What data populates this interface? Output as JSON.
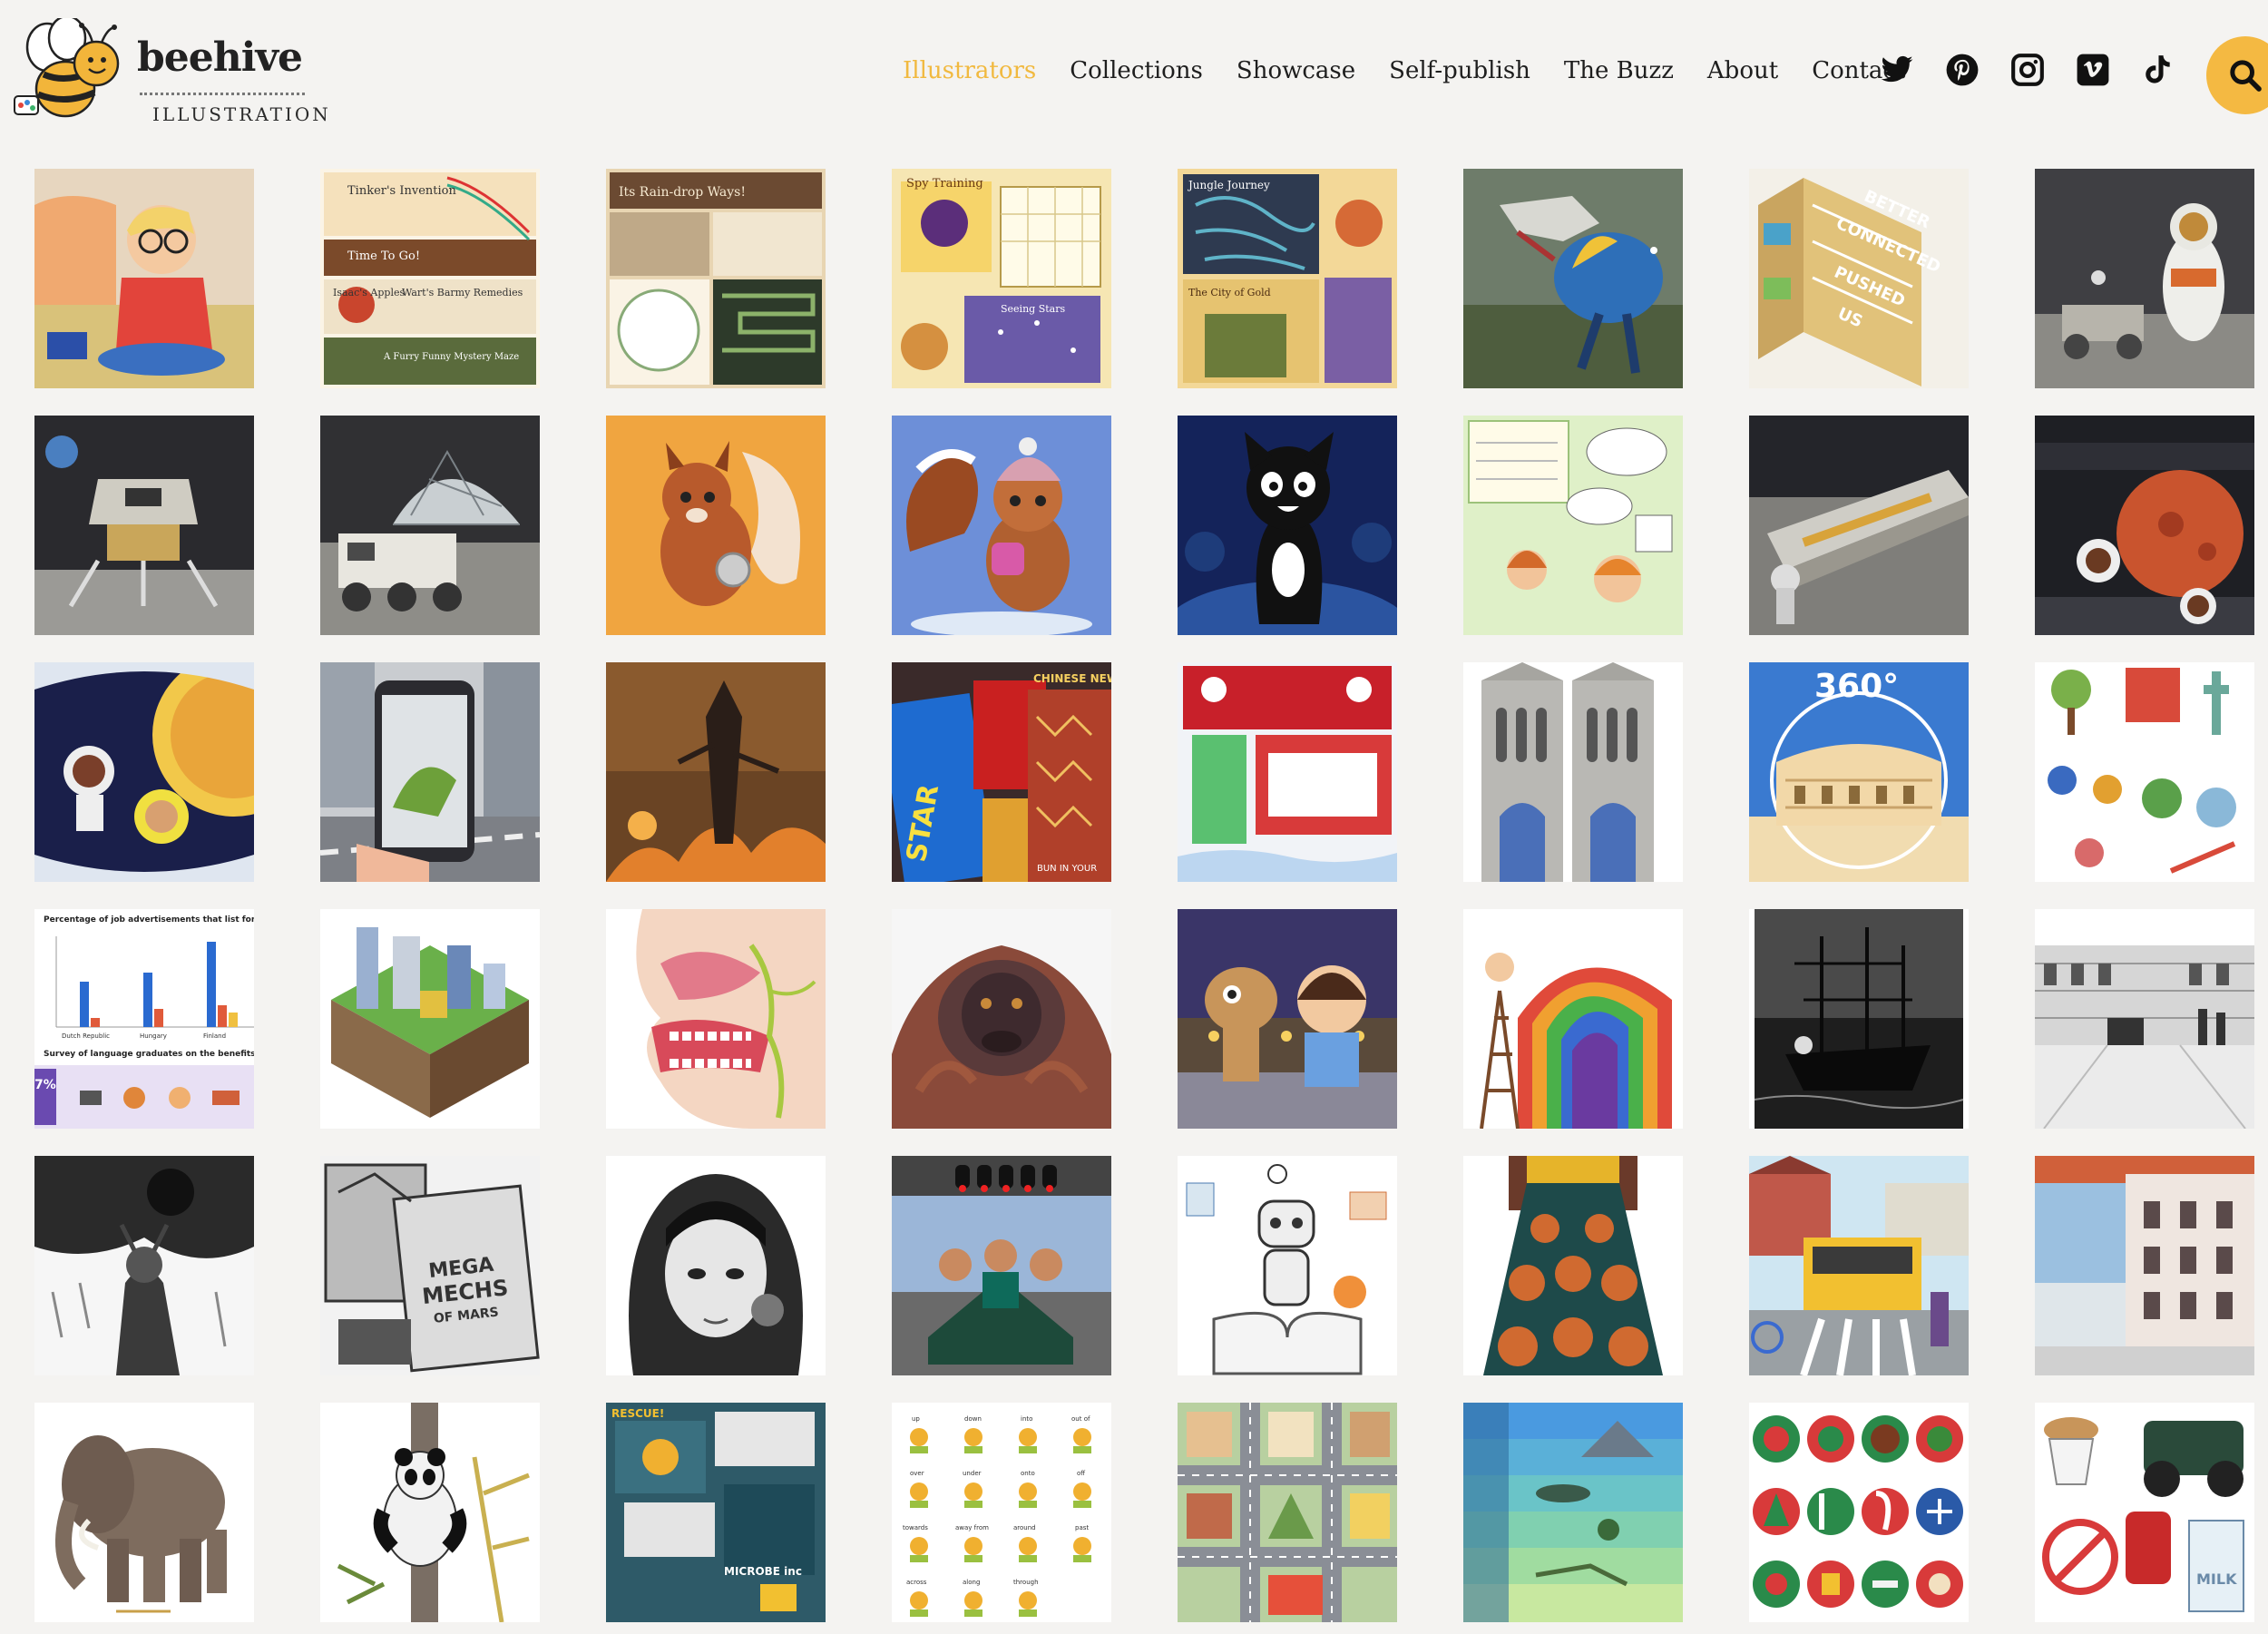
{
  "brand": {
    "name": "beehive",
    "subtitle": "ILLUSTRATION"
  },
  "nav": {
    "items": [
      {
        "label": "Illustrators",
        "active": true
      },
      {
        "label": "Collections",
        "active": false
      },
      {
        "label": "Showcase",
        "active": false
      },
      {
        "label": "Self-publish",
        "active": false
      },
      {
        "label": "The Buzz",
        "active": false
      },
      {
        "label": "About",
        "active": false
      },
      {
        "label": "Contact",
        "active": false
      }
    ]
  },
  "social": [
    "twitter-icon",
    "pinterest-icon",
    "instagram-icon",
    "vimeo-icon",
    "tiktok-icon"
  ],
  "colors": {
    "accent": "#f1b93f",
    "search_bg": "#f4b942",
    "text": "#1e1e1e",
    "background": "#f4f3f1"
  },
  "tiles": [
    {
      "text": []
    },
    {
      "text": [
        "Tinker's Invention",
        "Time To Go!",
        "Isaac's Apples",
        "Wart's Barmy Remedies",
        "A Furry Funny Mystery Maze"
      ]
    },
    {
      "text": [
        "Its Rain-drop Ways!"
      ]
    },
    {
      "text": [
        "Spy Training",
        "Seeing Stars"
      ]
    },
    {
      "text": [
        "Jungle Journey",
        "The City of Gold"
      ]
    },
    {
      "text": []
    },
    {
      "text": [
        "BETTER",
        "CONNECTED",
        "PUSHED",
        "US"
      ]
    },
    {
      "text": []
    },
    {
      "text": []
    },
    {
      "text": []
    },
    {
      "text": []
    },
    {
      "text": []
    },
    {
      "text": []
    },
    {
      "text": []
    },
    {
      "text": []
    },
    {
      "text": []
    },
    {
      "text": []
    },
    {
      "text": []
    },
    {
      "text": []
    },
    {
      "text": [
        "CHINESE NEW YEAR",
        "BUN IN YOUR",
        "STAR"
      ]
    },
    {
      "text": []
    },
    {
      "text": []
    },
    {
      "text": [
        "360°"
      ]
    },
    {
      "text": []
    },
    {
      "text": [
        "Percentage of job advertisements that list foreign la",
        "Dutch Republic",
        "Hungary",
        "Finland",
        "Survey of language graduates on the benefits of lea",
        "7%"
      ]
    },
    {
      "text": []
    },
    {
      "text": []
    },
    {
      "text": []
    },
    {
      "text": []
    },
    {
      "text": []
    },
    {
      "text": []
    },
    {
      "text": []
    },
    {
      "text": []
    },
    {
      "text": [
        "MEGA",
        "MECHS",
        "OF MARS"
      ]
    },
    {
      "text": []
    },
    {
      "text": []
    },
    {
      "text": []
    },
    {
      "text": []
    },
    {
      "text": []
    },
    {
      "text": []
    },
    {
      "text": []
    },
    {
      "text": []
    },
    {
      "text": [
        "RESCUE!",
        "MICROBE inc"
      ]
    },
    {
      "text": [
        "up",
        "down",
        "into",
        "out of",
        "over",
        "under",
        "onto",
        "off",
        "towards",
        "away from",
        "around",
        "past",
        "across",
        "along",
        "through"
      ]
    },
    {
      "text": []
    },
    {
      "text": []
    },
    {
      "text": []
    },
    {
      "text": [
        "MILK"
      ]
    }
  ]
}
